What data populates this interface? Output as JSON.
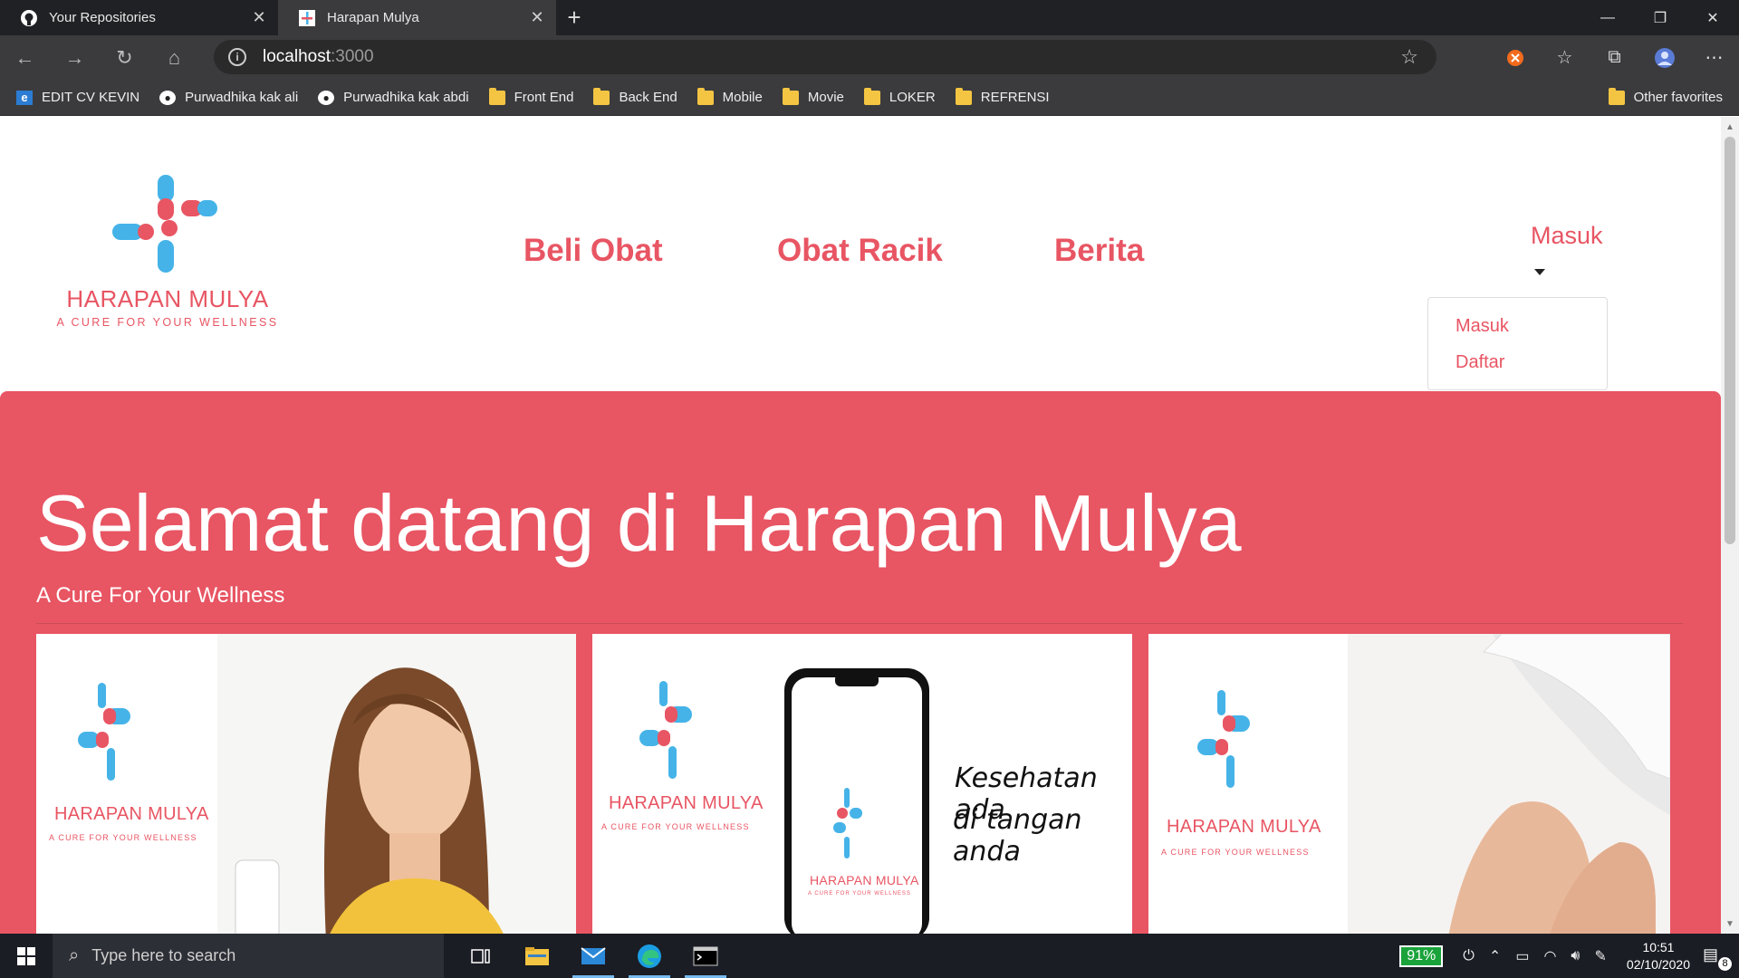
{
  "browser": {
    "tabs": [
      {
        "title": "Your Repositories",
        "active": false
      },
      {
        "title": "Harapan Mulya",
        "active": true
      }
    ],
    "address": {
      "host": "localhost",
      "port": ":3000"
    },
    "bookmarks": [
      {
        "label": "EDIT CV KEVIN",
        "icon": "edge-doc-icon"
      },
      {
        "label": "Purwadhika kak ali",
        "icon": "github-icon"
      },
      {
        "label": "Purwadhika kak abdi",
        "icon": "github-icon"
      },
      {
        "label": "Front End",
        "icon": "folder-icon"
      },
      {
        "label": "Back End",
        "icon": "folder-icon"
      },
      {
        "label": "Mobile",
        "icon": "folder-icon"
      },
      {
        "label": "Movie",
        "icon": "folder-icon"
      },
      {
        "label": "LOKER",
        "icon": "folder-icon"
      },
      {
        "label": "REFRENSI",
        "icon": "folder-icon"
      }
    ],
    "other_favorites": "Other favorites"
  },
  "site": {
    "logo": {
      "brand": "HARAPAN MULYA",
      "tagline": "A CURE FOR YOUR WELLNESS"
    },
    "nav": [
      "Beli Obat",
      "Obat Racik",
      "Berita"
    ],
    "account": {
      "toggle": "Masuk",
      "menu": [
        "Masuk",
        "Daftar"
      ]
    },
    "hero": {
      "title": "Selamat datang di Harapan Mulya",
      "subtitle": "A Cure For Your Wellness"
    },
    "cards": [
      {
        "brand": "HARAPAN MULYA",
        "tagline": "A CURE FOR YOUR WELLNESS"
      },
      {
        "brand": "HARAPAN MULYA",
        "tagline": "A CURE FOR YOUR WELLNESS",
        "caption_1": "Kesehatan ada",
        "caption_2": "di tangan anda",
        "phone_brand": "HARAPAN MULYA",
        "phone_tagline": "A CURE FOR YOUR WELLNESS"
      },
      {
        "brand": "HARAPAN MULYA",
        "tagline": "A CURE FOR YOUR WELLNESS"
      }
    ],
    "colors": {
      "brand_red": "#e85563",
      "brand_blue": "#45b3e8"
    }
  },
  "taskbar": {
    "search_placeholder": "Type here to search",
    "battery": "91%",
    "time": "10:51",
    "date": "02/10/2020",
    "notifications": "8"
  }
}
